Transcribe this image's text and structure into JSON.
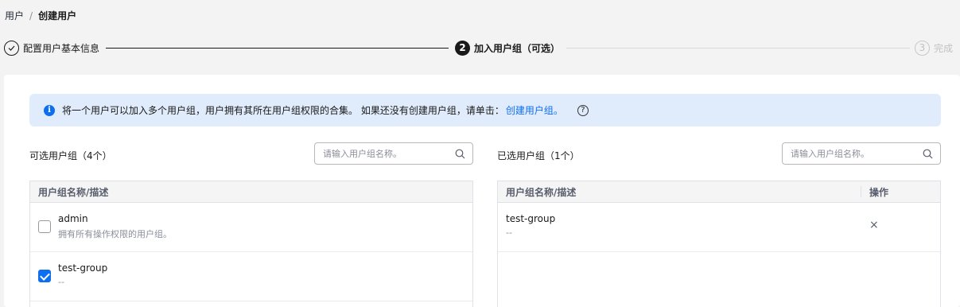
{
  "breadcrumb": {
    "parent": "用户",
    "separator": "/",
    "current": "创建用户"
  },
  "steps": [
    {
      "number": "✓",
      "label": "配置用户基本信息"
    },
    {
      "number": "2",
      "label": "加入用户组（可选）"
    },
    {
      "number": "3",
      "label": "完成"
    }
  ],
  "info": {
    "text": "将一个用户可以加入多个用户组，用户拥有其所在用户组权限的合集。 如果还没有创建用户组，请单击：",
    "link": "创建用户组。",
    "help": "?"
  },
  "available": {
    "title": "可选用户组（4个）",
    "search_placeholder": "请输入用户组名称。",
    "column": "用户组名称/描述",
    "rows": [
      {
        "name": "admin",
        "desc": "拥有所有操作权限的用户组。",
        "checked": false
      },
      {
        "name": "test-group",
        "desc": "--",
        "checked": true
      }
    ]
  },
  "selected": {
    "title": "已选用户组（1个）",
    "search_placeholder": "请输入用户组名称。",
    "column_name": "用户组名称/描述",
    "column_action": "操作",
    "rows": [
      {
        "name": "test-group",
        "desc": "--",
        "action": "×"
      }
    ]
  },
  "colors": {
    "accent": "#0d6ef0",
    "info_bg": "#e0ecfc",
    "page_bg": "#f3f3f3"
  }
}
